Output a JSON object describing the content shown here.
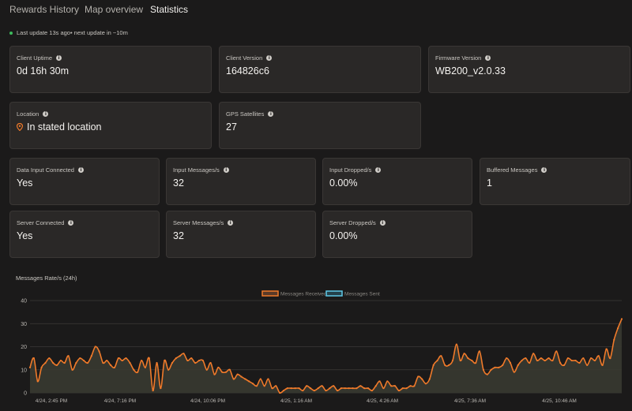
{
  "tabs": [
    {
      "label": "Rewards History",
      "active": false
    },
    {
      "label": "Map overview",
      "active": false
    },
    {
      "label": "Statistics",
      "active": true
    }
  ],
  "status": {
    "text": "Last update 13s ago• next update in ~10m",
    "color": "#3dbb5c"
  },
  "cards": {
    "client_uptime": {
      "label": "Client Uptime",
      "value": "0d 16h 30m"
    },
    "client_version": {
      "label": "Client Version",
      "value": "164826c6"
    },
    "firmware_version": {
      "label": "Firmware Version",
      "value": "WB200_v2.0.33"
    },
    "location": {
      "label": "Location",
      "value": "In stated location",
      "icon": "location-pin-icon",
      "icon_color": "#f07a2a"
    },
    "gps_satellites": {
      "label": "GPS Satellites",
      "value": "27"
    },
    "data_input_connected": {
      "label": "Data Input Connected",
      "value": "Yes"
    },
    "input_messages": {
      "label": "Input Messages/s",
      "value": "32"
    },
    "input_dropped": {
      "label": "Input Dropped/s",
      "value": "0.00%"
    },
    "buffered_messages": {
      "label": "Buffered Messages",
      "value": "1"
    },
    "server_connected": {
      "label": "Server Connected",
      "value": "Yes"
    },
    "server_messages": {
      "label": "Server Messages/s",
      "value": "32"
    },
    "server_dropped": {
      "label": "Server Dropped/s",
      "value": "0.00%"
    }
  },
  "info_icon": "info-icon",
  "chart_data": {
    "type": "area",
    "title": "Messages Rate/s (24h)",
    "xlabel": "",
    "ylabel": "",
    "ylim": [
      0,
      40
    ],
    "yticks": [
      0,
      10,
      20,
      30,
      40
    ],
    "grid": true,
    "legend_position": "top-center",
    "x_tick_labels": [
      "4/24, 2:45 PM",
      "4/24, 7:16 PM",
      "4/24, 10:06 PM",
      "4/25, 1:16 AM",
      "4/25, 4:26 AM",
      "4/25, 7:36 AM",
      "4/25, 10:46 AM"
    ],
    "series": [
      {
        "name": "Messages Received",
        "color": "#f07a2a",
        "values": [
          11,
          15,
          5,
          11,
          13,
          15,
          13,
          12,
          14,
          13,
          16,
          10,
          13,
          15,
          14,
          13,
          16,
          20,
          18,
          13,
          14,
          12,
          11,
          15,
          14,
          15,
          13,
          10,
          9,
          14,
          11,
          15,
          1,
          13,
          2,
          14,
          10,
          13,
          15,
          16,
          17,
          14,
          15,
          13,
          14,
          14,
          10,
          13,
          8,
          11,
          9,
          9,
          10,
          6,
          8,
          7,
          6,
          5,
          4,
          3,
          6,
          3,
          6,
          2,
          3,
          0,
          1,
          2,
          2,
          2,
          2,
          1,
          3,
          2,
          1,
          2,
          3,
          1,
          2,
          3,
          1,
          2,
          2,
          2,
          2,
          2,
          3,
          2,
          2,
          1,
          3,
          5,
          2,
          5,
          3,
          3,
          1,
          2,
          2,
          3,
          3,
          7,
          6,
          4,
          6,
          12,
          14,
          16,
          12,
          12,
          14,
          21,
          14,
          17,
          15,
          14,
          13,
          18,
          10,
          8,
          10,
          11,
          11,
          12,
          15,
          13,
          9,
          12,
          14,
          15,
          13,
          17,
          14,
          15,
          14,
          15,
          14,
          18,
          13,
          12,
          15,
          14,
          14,
          13,
          15,
          12,
          15,
          14,
          16,
          12,
          19,
          15,
          23,
          28,
          32
        ]
      },
      {
        "name": "Messages Sent",
        "color": "#5ec8e6",
        "values": []
      }
    ]
  }
}
